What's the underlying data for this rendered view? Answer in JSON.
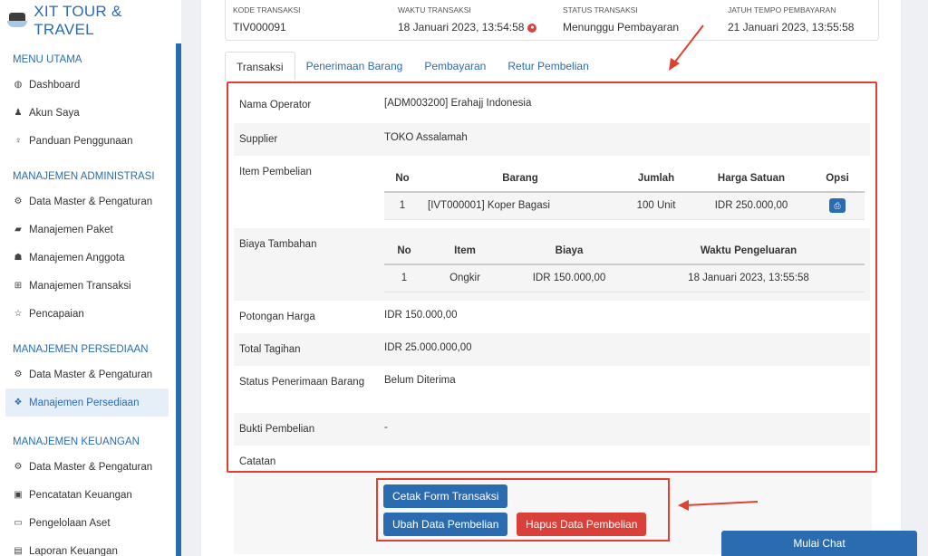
{
  "brand": {
    "title": "XIT TOUR & TRAVEL"
  },
  "sidebar": {
    "sections": [
      {
        "title": "MENU UTAMA",
        "items": [
          {
            "label": "Dashboard",
            "icon": "dashboard-icon"
          },
          {
            "label": "Akun Saya",
            "icon": "user-icon"
          },
          {
            "label": "Panduan Penggunaan",
            "icon": "lightbulb-icon"
          }
        ]
      },
      {
        "title": "MANAJEMEN ADMINISTRASI",
        "items": [
          {
            "label": "Data Master & Pengaturan",
            "icon": "gears-icon"
          },
          {
            "label": "Manajemen Paket",
            "icon": "book-icon"
          },
          {
            "label": "Manajemen Anggota",
            "icon": "users-icon"
          },
          {
            "label": "Manajemen Transaksi",
            "icon": "cart-icon"
          },
          {
            "label": "Pencapaian",
            "icon": "star-icon"
          }
        ]
      },
      {
        "title": "MANAJEMEN PERSEDIAAN",
        "items": [
          {
            "label": "Data Master & Pengaturan",
            "icon": "gears-icon"
          },
          {
            "label": "Manajemen Persediaan",
            "icon": "cubes-icon",
            "active": true
          }
        ]
      },
      {
        "title": "MANAJEMEN KEUANGAN",
        "items": [
          {
            "label": "Data Master & Pengaturan",
            "icon": "gears-icon"
          },
          {
            "label": "Pencatatan Keuangan",
            "icon": "money-icon"
          },
          {
            "label": "Pengelolaan Aset",
            "icon": "drive-icon"
          },
          {
            "label": "Laporan Keuangan",
            "icon": "chart-icon"
          }
        ]
      }
    ]
  },
  "header": {
    "kode_label": "KODE TRANSAKSI",
    "kode_value": "TIV000091",
    "waktu_label": "WAKTU TRANSAKSI",
    "waktu_value": "18 Januari 2023, 13:54:58",
    "status_label": "STATUS TRANSAKSI",
    "status_value": "Menunggu Pembayaran",
    "jatuh_label": "JATUH TEMPO PEMBAYARAN",
    "jatuh_value": "21 Januari 2023, 13:55:58"
  },
  "tabs": [
    "Transaksi",
    "Penerimaan Barang",
    "Pembayaran",
    "Retur Pembelian"
  ],
  "detail": {
    "operator_label": "Nama Operator",
    "operator_value": "[ADM003200] Erahajj Indonesia",
    "supplier_label": "Supplier",
    "supplier_value": "TOKO Assalamah",
    "item_label": "Item Pembelian",
    "item_headers": [
      "No",
      "Barang",
      "Jumlah",
      "Harga Satuan",
      "Opsi"
    ],
    "item_rows": [
      {
        "no": "1",
        "barang": "[IVT000001] Koper Bagasi",
        "jumlah": "100 Unit",
        "harga": "IDR 250.000,00"
      }
    ],
    "biaya_label": "Biaya Tambahan",
    "biaya_headers": [
      "No",
      "Item",
      "Biaya",
      "Waktu Pengeluaran"
    ],
    "biaya_rows": [
      {
        "no": "1",
        "item": "Ongkir",
        "biaya": "IDR 150.000,00",
        "waktu": "18 Januari 2023, 13:55:58"
      }
    ],
    "potongan_label": "Potongan Harga",
    "potongan_value": "IDR 150.000,00",
    "total_label": "Total Tagihan",
    "total_value": "IDR 25.000.000,00",
    "status_label": "Status Penerimaan Barang",
    "status_value": "Belum Diterima",
    "bukti_label": "Bukti Pembelian",
    "bukti_value": "-",
    "catatan_label": "Catatan"
  },
  "actions": {
    "cetak": "Cetak Form Transaksi",
    "ubah": "Ubah Data Pembelian",
    "hapus": "Hapus Data Pembelian"
  },
  "chat": {
    "label": "Mulai Chat"
  },
  "colors": {
    "primary": "#2b6cb0",
    "danger": "#d9403a",
    "annotation": "#e0402f"
  }
}
